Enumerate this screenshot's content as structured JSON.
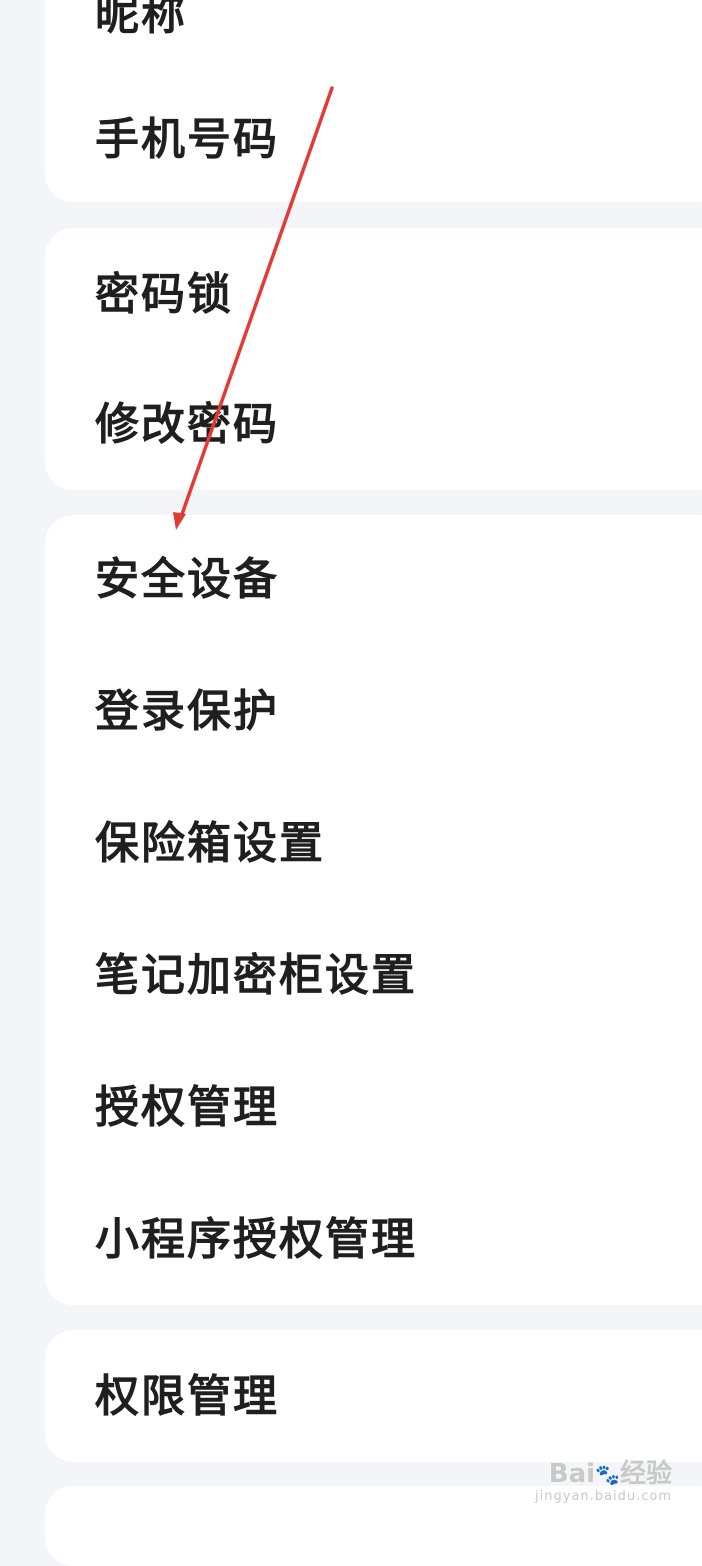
{
  "sections": [
    {
      "items": [
        {
          "label": "昵称"
        },
        {
          "label": "手机号码"
        }
      ]
    },
    {
      "items": [
        {
          "label": "密码锁"
        },
        {
          "label": "修改密码"
        }
      ]
    },
    {
      "items": [
        {
          "label": "安全设备"
        },
        {
          "label": "登录保护"
        },
        {
          "label": "保险箱设置"
        },
        {
          "label": "笔记加密柜设置"
        },
        {
          "label": "授权管理"
        },
        {
          "label": "小程序授权管理"
        }
      ]
    },
    {
      "items": [
        {
          "label": "权限管理"
        }
      ]
    }
  ],
  "annotation": {
    "color": "#e53935"
  },
  "watermark": {
    "main_left": "Bai",
    "paw": "🐾",
    "main_right": "经验",
    "sub": "jingyan.baidu.com"
  }
}
